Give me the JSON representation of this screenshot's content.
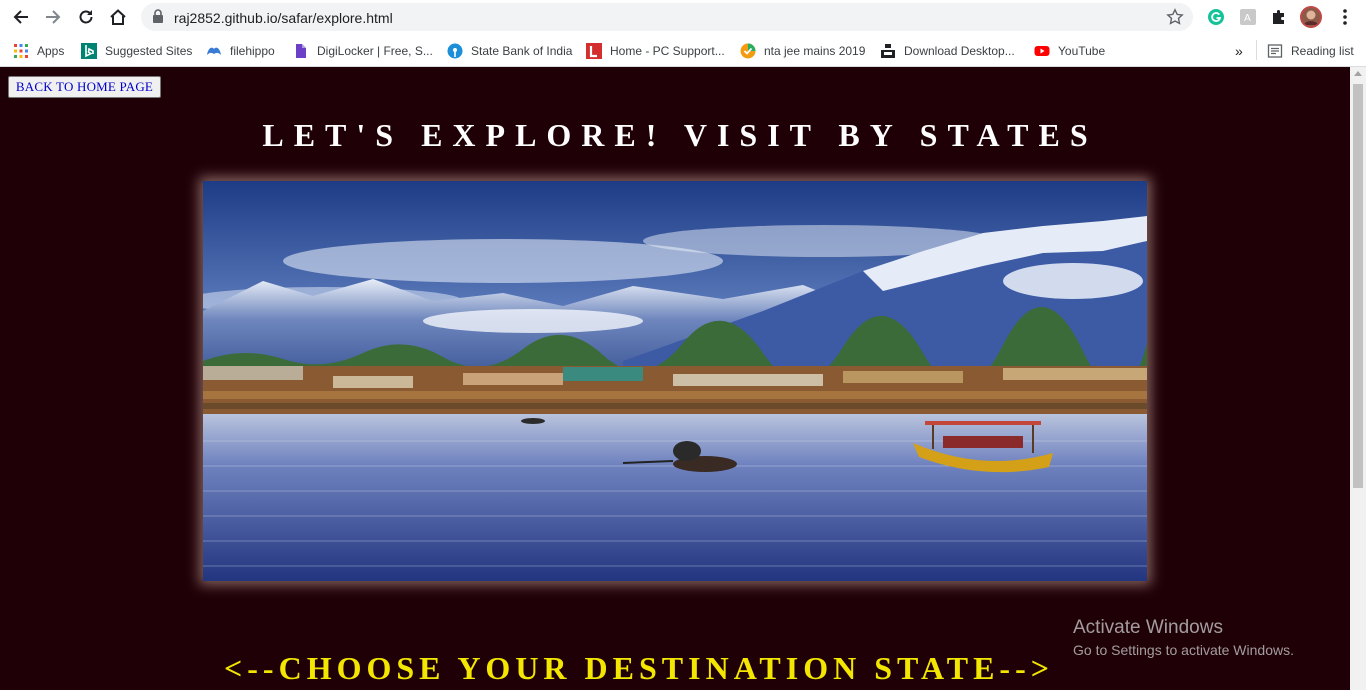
{
  "browser": {
    "url": "raj2852.github.io/safar/explore.html",
    "nav_icons": [
      "back-arrow-icon",
      "forward-arrow-icon",
      "reload-icon",
      "home-icon"
    ],
    "extension_icons": [
      "grammarly-icon",
      "translate-extension-icon",
      "puzzle-extensions-icon"
    ],
    "profile_icon": "profile-avatar-icon",
    "menu_icon": "kebab-menu-icon"
  },
  "bookmarks": {
    "items": [
      {
        "label": "Apps",
        "icon": "apps-grid-icon"
      },
      {
        "label": "Suggested Sites",
        "icon": "bing-icon"
      },
      {
        "label": "filehippo",
        "icon": "filehippo-icon"
      },
      {
        "label": "DigiLocker | Free, S...",
        "icon": "digilocker-icon"
      },
      {
        "label": "State Bank of India",
        "icon": "sbi-icon"
      },
      {
        "label": "Home - PC Support...",
        "icon": "pc-support-icon"
      },
      {
        "label": "nta jee mains 2019",
        "icon": "nta-icon"
      },
      {
        "label": "Download Desktop...",
        "icon": "download-desktop-icon"
      },
      {
        "label": "YouTube",
        "icon": "youtube-icon"
      }
    ],
    "more_label": "»",
    "reading_list_label": "Reading list"
  },
  "page": {
    "back_button_label": "BACK TO HOME PAGE",
    "title": "LET'S EXPLORE! VISIT BY STATES",
    "choose_text": "<--CHOOSE YOUR DESTINATION STATE-->",
    "background_color": "#1f0007",
    "choose_color": "#f3e600"
  },
  "watermark": {
    "line1": "Activate Windows",
    "line2": "Go to Settings to activate Windows."
  }
}
